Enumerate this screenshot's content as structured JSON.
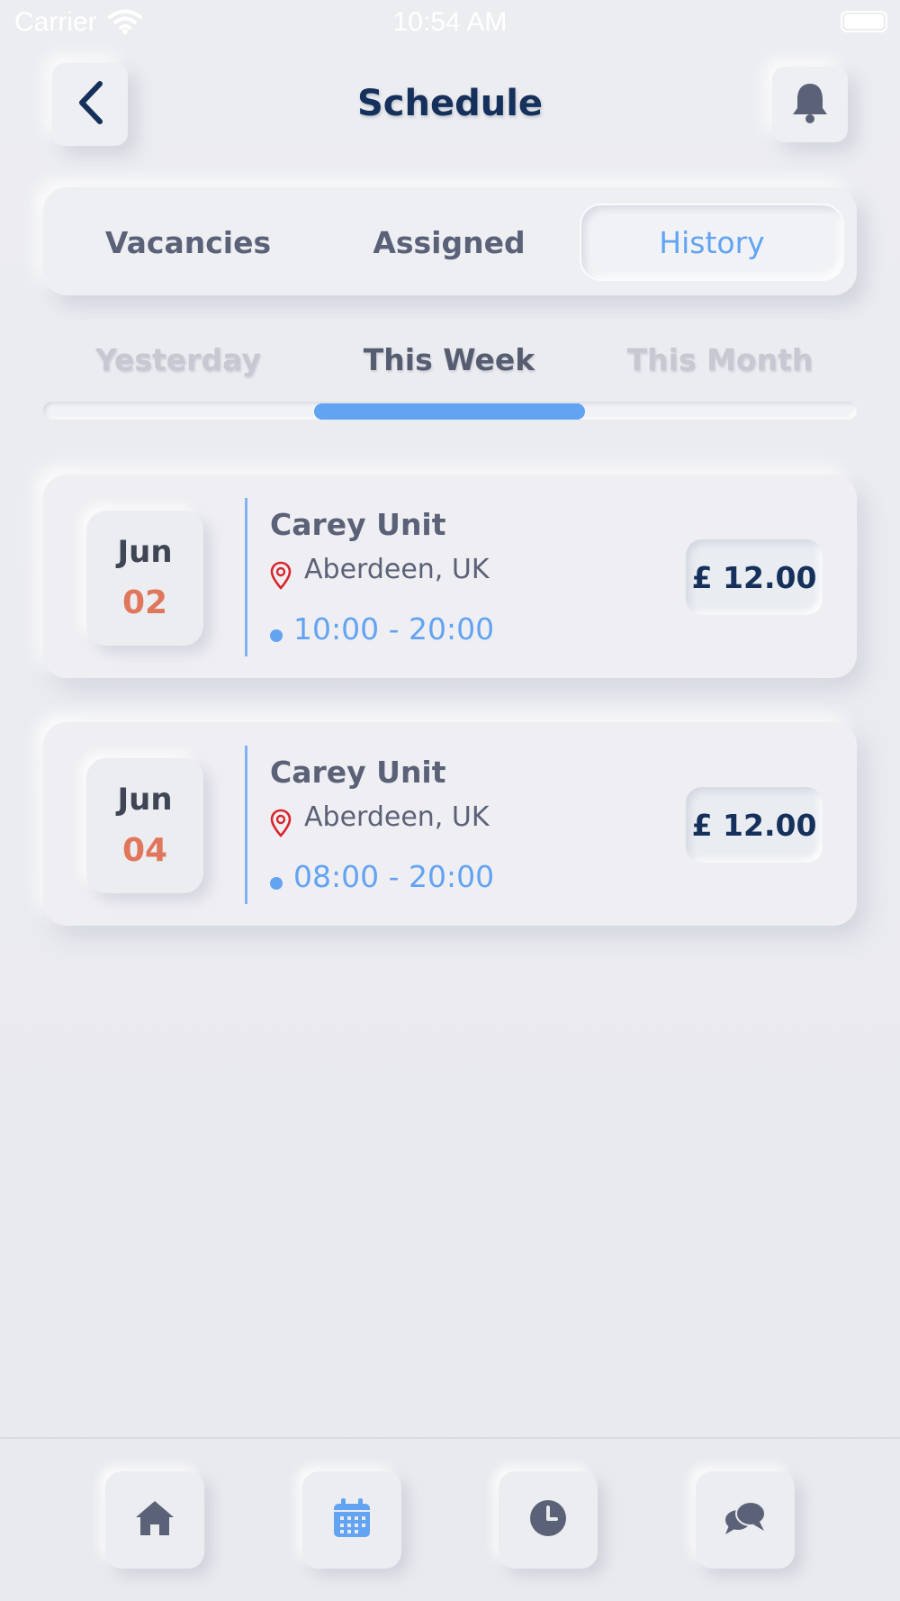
{
  "status_bar": {
    "carrier": "Carrier",
    "time": "10:54 AM"
  },
  "header": {
    "title": "Schedule",
    "back_icon": "chevron-left-icon",
    "notification_icon": "bell-icon"
  },
  "segments": {
    "tabs": [
      "Vacancies",
      "Assigned",
      "History"
    ],
    "active": "History"
  },
  "periods": {
    "items": [
      "Yesterday",
      "This Week",
      "This Month"
    ],
    "active": "This Week"
  },
  "shifts": [
    {
      "month": "Jun",
      "day": "02",
      "unit": "Carey Unit",
      "location": "Aberdeen, UK",
      "time": "10:00 - 20:00",
      "price": "£ 12.00"
    },
    {
      "month": "Jun",
      "day": "04",
      "unit": "Carey Unit",
      "location": "Aberdeen, UK",
      "time": "08:00 - 20:00",
      "price": "£ 12.00"
    }
  ],
  "bottom_nav": {
    "items": [
      "home-icon",
      "calendar-icon",
      "clock-icon",
      "chat-icon"
    ],
    "active": "calendar-icon"
  },
  "colors": {
    "accent": "#62a3f2",
    "title": "#15305a",
    "date_day": "#e0765c",
    "text": "#5b6278",
    "muted": "#c6c8d2",
    "background": "#e9eaee"
  }
}
